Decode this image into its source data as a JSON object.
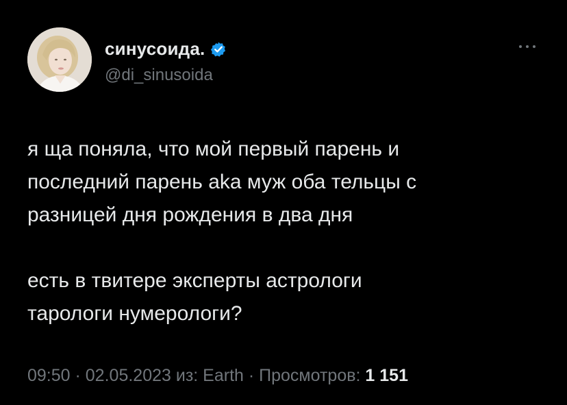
{
  "author": {
    "display_name": "синусоида.",
    "handle": "@di_sinusoida",
    "verified": true
  },
  "tweet": {
    "paragraphs": [
      [
        "я ща поняла, что мой первый парень и",
        "последний парень aka муж оба тельцы с",
        "разницей дня рождения в два дня"
      ],
      [
        "есть в твитере эксперты астрологи",
        "тарологи нумерологи?"
      ]
    ]
  },
  "meta": {
    "time": "09:50",
    "sep1": " · ",
    "date": "02.05.2023",
    "source": " из: Earth",
    "sep2": " · ",
    "views_label": "Просмотров: ",
    "views_count": "1 151"
  },
  "icons": {
    "verified": "verified-badge-icon",
    "more": "more-horizontal-icon"
  },
  "colors": {
    "background": "#000000",
    "primary_text": "#e7e9ea",
    "secondary_text": "#71767b",
    "verified_blue": "#1d9bf0"
  }
}
